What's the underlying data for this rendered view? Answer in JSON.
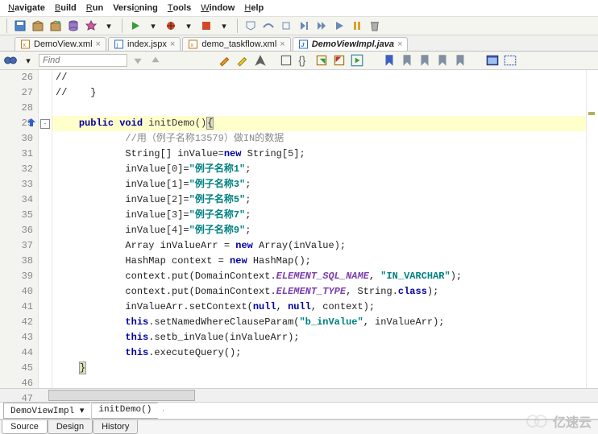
{
  "menubar": {
    "items": [
      {
        "pre": "",
        "u": "N",
        "post": "avigate"
      },
      {
        "pre": "",
        "u": "B",
        "post": "uild"
      },
      {
        "pre": "",
        "u": "R",
        "post": "un"
      },
      {
        "pre": "Versi",
        "u": "o",
        "post": "ning"
      },
      {
        "pre": "",
        "u": "T",
        "post": "ools"
      },
      {
        "pre": "",
        "u": "W",
        "post": "indow"
      },
      {
        "pre": "",
        "u": "H",
        "post": "elp"
      }
    ]
  },
  "tabs": [
    {
      "label": "DemoView.xml",
      "active": false,
      "icon": "xml"
    },
    {
      "label": "index.jspx",
      "active": false,
      "icon": "jsp"
    },
    {
      "label": "demo_taskflow.xml",
      "active": false,
      "icon": "xml"
    },
    {
      "label": "DemoViewImpl.java",
      "active": true,
      "icon": "java"
    }
  ],
  "findbar": {
    "placeholder": "Find"
  },
  "gutter": {
    "start": 26,
    "end": 47,
    "highlight": 29
  },
  "code": {
    "lines": [
      {
        "n": 26,
        "indent": 0,
        "segs": [
          [
            "p",
            "//"
          ]
        ]
      },
      {
        "n": 27,
        "indent": 0,
        "segs": [
          [
            "p",
            "//    }"
          ]
        ]
      },
      {
        "n": 28,
        "indent": 0,
        "segs": []
      },
      {
        "n": 29,
        "indent": 1,
        "hl": true,
        "segs": [
          [
            "kw1",
            "public"
          ],
          [
            "p",
            " "
          ],
          [
            "kw1",
            "void"
          ],
          [
            "p",
            " "
          ],
          [
            "meth",
            "initDemo()"
          ],
          [
            "brace",
            "{"
          ]
        ]
      },
      {
        "n": 30,
        "indent": 3,
        "segs": [
          [
            "cmt",
            "//用（例子名称13579）做IN的数据"
          ]
        ]
      },
      {
        "n": 31,
        "indent": 3,
        "segs": [
          [
            "p",
            "String[] inValue="
          ],
          [
            "kw2",
            "new"
          ],
          [
            "p",
            " String["
          ],
          [
            "num",
            "5"
          ],
          [
            "p",
            "];"
          ]
        ]
      },
      {
        "n": 32,
        "indent": 3,
        "segs": [
          [
            "p",
            "inValue["
          ],
          [
            "num",
            "0"
          ],
          [
            "p",
            "]="
          ],
          [
            "str",
            "\"例子名称1\""
          ],
          [
            "p",
            ";"
          ]
        ]
      },
      {
        "n": 33,
        "indent": 3,
        "segs": [
          [
            "p",
            "inValue["
          ],
          [
            "num",
            "1"
          ],
          [
            "p",
            "]="
          ],
          [
            "str",
            "\"例子名称3\""
          ],
          [
            "p",
            ";"
          ]
        ]
      },
      {
        "n": 34,
        "indent": 3,
        "segs": [
          [
            "p",
            "inValue["
          ],
          [
            "num",
            "2"
          ],
          [
            "p",
            "]="
          ],
          [
            "str",
            "\"例子名称5\""
          ],
          [
            "p",
            ";"
          ]
        ]
      },
      {
        "n": 35,
        "indent": 3,
        "segs": [
          [
            "p",
            "inValue["
          ],
          [
            "num",
            "3"
          ],
          [
            "p",
            "]="
          ],
          [
            "str",
            "\"例子名称7\""
          ],
          [
            "p",
            ";"
          ]
        ]
      },
      {
        "n": 36,
        "indent": 3,
        "segs": [
          [
            "p",
            "inValue["
          ],
          [
            "num",
            "4"
          ],
          [
            "p",
            "]="
          ],
          [
            "str",
            "\"例子名称9\""
          ],
          [
            "p",
            ";"
          ]
        ]
      },
      {
        "n": 37,
        "indent": 3,
        "segs": [
          [
            "p",
            "Array inValueArr = "
          ],
          [
            "kw2",
            "new"
          ],
          [
            "p",
            " Array(inValue);"
          ]
        ]
      },
      {
        "n": 38,
        "indent": 3,
        "segs": [
          [
            "p",
            "HashMap context = "
          ],
          [
            "kw2",
            "new"
          ],
          [
            "p",
            " HashMap();"
          ]
        ]
      },
      {
        "n": 39,
        "indent": 3,
        "segs": [
          [
            "p",
            "context.put(DomainContext."
          ],
          [
            "const",
            "ELEMENT_SQL_NAME"
          ],
          [
            "p",
            ", "
          ],
          [
            "str",
            "\"IN_VARCHAR\""
          ],
          [
            "p",
            ");"
          ]
        ]
      },
      {
        "n": 40,
        "indent": 3,
        "segs": [
          [
            "p",
            "context.put(DomainContext."
          ],
          [
            "const",
            "ELEMENT_TYPE"
          ],
          [
            "p",
            ", String."
          ],
          [
            "kw1",
            "class"
          ],
          [
            "p",
            ");"
          ]
        ]
      },
      {
        "n": 41,
        "indent": 3,
        "segs": [
          [
            "p",
            "inValueArr.setContext("
          ],
          [
            "kw2",
            "null"
          ],
          [
            "p",
            ", "
          ],
          [
            "kw2",
            "null"
          ],
          [
            "p",
            ", context);"
          ]
        ]
      },
      {
        "n": 42,
        "indent": 3,
        "segs": [
          [
            "kw2",
            "this"
          ],
          [
            "p",
            ".setNamedWhereClauseParam("
          ],
          [
            "str",
            "\"b_inValue\""
          ],
          [
            "p",
            ", inValueArr);"
          ]
        ]
      },
      {
        "n": 43,
        "indent": 3,
        "segs": [
          [
            "kw2",
            "this"
          ],
          [
            "p",
            ".setb_inValue(inValueArr);"
          ]
        ]
      },
      {
        "n": 44,
        "indent": 3,
        "segs": [
          [
            "kw2",
            "this"
          ],
          [
            "p",
            ".executeQuery();"
          ]
        ]
      },
      {
        "n": 45,
        "indent": 1,
        "segs": [
          [
            "brace",
            "}"
          ]
        ]
      },
      {
        "n": 46,
        "indent": 0,
        "segs": []
      },
      {
        "n": 47,
        "indent": 0,
        "segs": []
      }
    ]
  },
  "breadcrumb": [
    "DemoViewImpl ▾",
    "initDemo()"
  ],
  "bottomTabs": [
    {
      "label": "Source",
      "active": true
    },
    {
      "label": "Design",
      "active": false
    },
    {
      "label": "History",
      "active": false
    }
  ],
  "watermark": "亿速云"
}
